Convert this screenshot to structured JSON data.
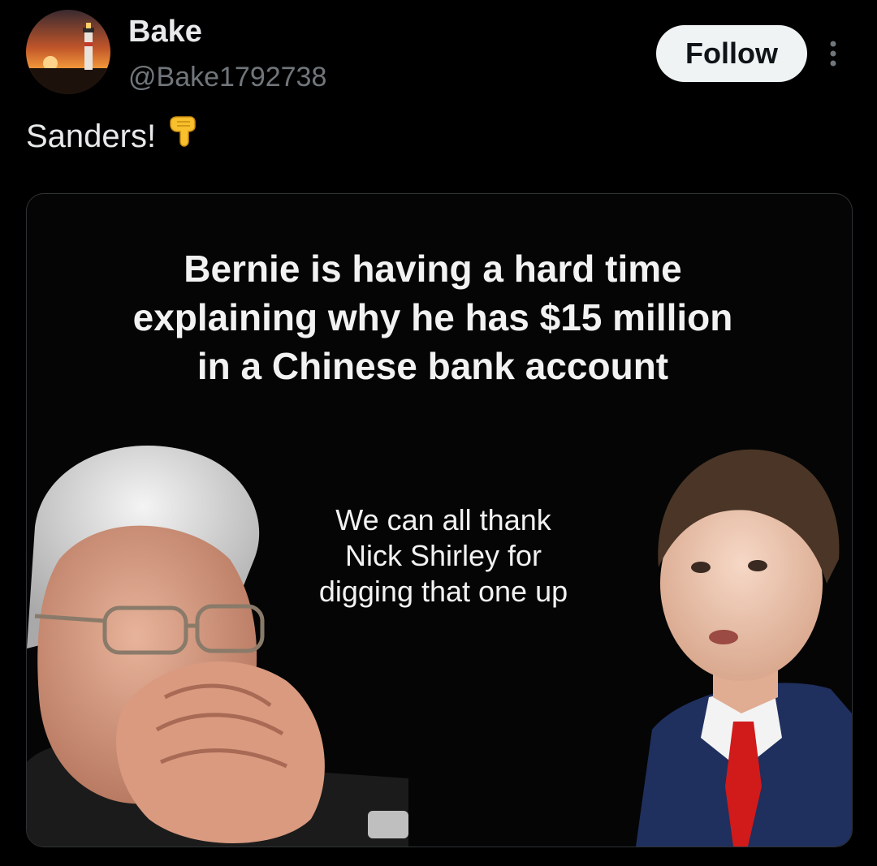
{
  "user": {
    "display_name": "Bake",
    "handle": "@Bake1792738",
    "avatar_icon": "lighthouse-sunset-avatar"
  },
  "actions": {
    "follow_label": "Follow",
    "more_icon": "more-vertical-icon"
  },
  "tweet": {
    "text": "Sanders!",
    "emoji": "backhand-index-pointing-down-emoji"
  },
  "media": {
    "headline_lines": [
      "Bernie is having a hard time",
      "explaining why he has $15 million",
      "in a Chinese bank account"
    ],
    "subtext_lines": [
      "We can all thank",
      "Nick Shirley for",
      "digging that one up"
    ]
  },
  "colors": {
    "background": "#000000",
    "primary_text": "#e7e9ea",
    "secondary_text": "#71767b",
    "follow_button_bg": "#eff3f4",
    "follow_button_text": "#0f1419",
    "emoji_yellow": "#f7c02c"
  }
}
